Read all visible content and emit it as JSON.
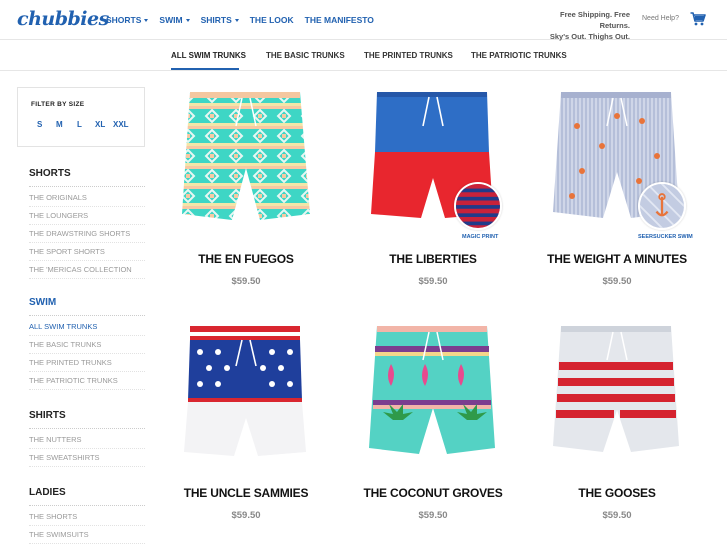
{
  "header": {
    "logo": "chubbies",
    "nav": [
      {
        "label": "SHORTS",
        "dropdown": true
      },
      {
        "label": "SWIM",
        "dropdown": true
      },
      {
        "label": "SHIRTS",
        "dropdown": true
      },
      {
        "label": "THE LOOK",
        "dropdown": false
      },
      {
        "label": "THE MANIFESTO",
        "dropdown": false
      }
    ],
    "promo_line1": "Free Shipping. Free Returns.",
    "promo_line2": "Sky's Out. Thighs Out.",
    "help": "Need Help?",
    "cart_icon": "cart-icon"
  },
  "subnav": {
    "tabs": [
      "ALL SWIM TRUNKS",
      "THE BASIC TRUNKS",
      "THE PRINTED TRUNKS",
      "THE PATRIOTIC TRUNKS"
    ],
    "active": "ALL SWIM TRUNKS"
  },
  "filter": {
    "title": "FILTER BY SIZE",
    "sizes": [
      "S",
      "M",
      "L",
      "XL",
      "XXL"
    ]
  },
  "sidebar": {
    "shorts": {
      "heading": "SHORTS",
      "links": [
        "THE ORIGINALS",
        "THE LOUNGERS",
        "THE DRAWSTRING SHORTS",
        "THE SPORT SHORTS",
        "THE 'MERICAS COLLECTION"
      ]
    },
    "swim": {
      "heading": "SWIM",
      "links": [
        "ALL SWIM TRUNKS",
        "THE BASIC TRUNKS",
        "THE PRINTED TRUNKS",
        "THE PATRIOTIC TRUNKS"
      ]
    },
    "shirts": {
      "heading": "SHIRTS",
      "links": [
        "THE NUTTERS",
        "THE SWEATSHIRTS"
      ]
    },
    "ladies": {
      "heading": "LADIES",
      "links": [
        "THE SHORTS",
        "THE SWIMSUITS"
      ]
    }
  },
  "products": [
    {
      "name": "THE EN FUEGOS",
      "price": "$59.50",
      "caption": ""
    },
    {
      "name": "THE LIBERTIES",
      "price": "$59.50",
      "caption": "MAGIC PRINT"
    },
    {
      "name": "THE WEIGHT A MINUTES",
      "price": "$59.50",
      "caption": "SEERSUCKER SWIM"
    },
    {
      "name": "THE UNCLE SAMMIES",
      "price": "$59.50",
      "caption": ""
    },
    {
      "name": "THE COCONUT GROVES",
      "price": "$59.50",
      "caption": ""
    },
    {
      "name": "THE GOOSES",
      "price": "$59.50",
      "caption": ""
    }
  ],
  "colors": {
    "brand_blue": "#2161b0",
    "muted": "#9a9a9a"
  }
}
